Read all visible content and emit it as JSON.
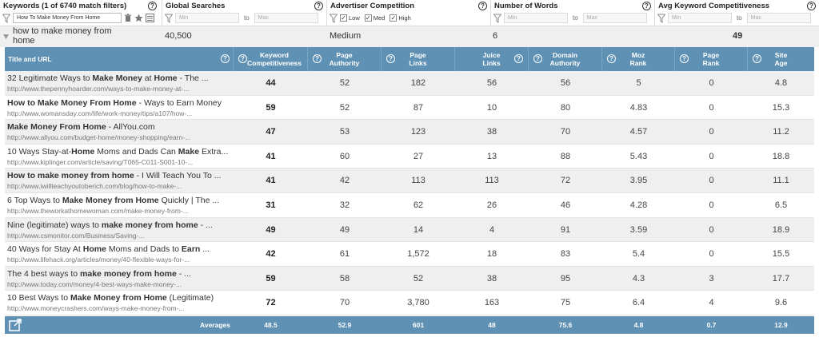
{
  "filters": {
    "keywords": {
      "title": "Keywords (1 of 6740 match filters)",
      "value": "How To Make Money From Home"
    },
    "global_searches": {
      "title": "Global Searches",
      "min_placeholder": "Min",
      "to": "to",
      "max_placeholder": "Max"
    },
    "advertiser_competition": {
      "title": "Advertiser Competition",
      "options": [
        "Low",
        "Med",
        "High"
      ]
    },
    "number_of_words": {
      "title": "Number of Words",
      "min_placeholder": "Min",
      "to": "to",
      "max_placeholder": "Max"
    },
    "avg_kc": {
      "title": "Avg Keyword Competitiveness",
      "min_placeholder": "Min",
      "to": "to",
      "max_placeholder": "Max"
    }
  },
  "summary": {
    "keyword_line1": "how to make money from",
    "keyword_line2": "home",
    "global_searches": "40,500",
    "competition": "Medium",
    "words": "6",
    "avg_kc": "49"
  },
  "columns": [
    {
      "label": "Title and URL"
    },
    {
      "label": "Keyword Competitiveness"
    },
    {
      "label": "Page Authority"
    },
    {
      "label": "Page Links"
    },
    {
      "label": "Juice Links"
    },
    {
      "label": "Domain Authority"
    },
    {
      "label": "Moz Rank"
    },
    {
      "label": "Page Rank"
    },
    {
      "label": "Site Age"
    }
  ],
  "rows": [
    {
      "title_html": "32 Legitimate Ways to <b>Make Money</b> at <b>Home</b> - The ...",
      "url": "http://www.thepennyhoarder.com/ways-to-make-money-at-...",
      "kc": "44",
      "pa": "52",
      "pl": "182",
      "jl": "56",
      "da": "56",
      "mr": "5",
      "pr": "0",
      "age": "4.8"
    },
    {
      "title_html": "<b>How to Make Money From Home</b> - Ways to Earn Money",
      "url": "http://www.womansday.com/life/work-money/tips/a107/how-...",
      "kc": "59",
      "pa": "52",
      "pl": "87",
      "jl": "10",
      "da": "80",
      "mr": "4.83",
      "pr": "0",
      "age": "15.3"
    },
    {
      "title_html": "<b>Make Money From Home</b> - AllYou.com",
      "url": "http://www.allyou.com/budget-home/money-shopping/earn-...",
      "kc": "47",
      "pa": "53",
      "pl": "123",
      "jl": "38",
      "da": "70",
      "mr": "4.57",
      "pr": "0",
      "age": "11.2"
    },
    {
      "title_html": "10 Ways Stay-at-<b>Home</b> Moms and Dads Can <b>Make</b> Extra...",
      "url": "http://www.kiplinger.com/article/saving/T065-C011-S001-10-...",
      "kc": "41",
      "pa": "60",
      "pl": "27",
      "jl": "13",
      "da": "88",
      "mr": "5.43",
      "pr": "0",
      "age": "18.8"
    },
    {
      "title_html": "<b>How to make money from home</b> - I Will Teach You To ...",
      "url": "http://www.iwillteachyoutoberich.com/blog/how-to-make-...",
      "kc": "41",
      "pa": "42",
      "pl": "113",
      "jl": "113",
      "da": "72",
      "mr": "3.95",
      "pr": "0",
      "age": "11.1"
    },
    {
      "title_html": "6 Top Ways to <b>Make Money from Home</b> Quickly | The ...",
      "url": "http://www.theworkathomewoman.com/make-money-from-...",
      "kc": "31",
      "pa": "32",
      "pl": "62",
      "jl": "26",
      "da": "46",
      "mr": "4.28",
      "pr": "0",
      "age": "6.5"
    },
    {
      "title_html": "Nine (legitimate) ways to <b>make money from home</b> - ...",
      "url": "http://www.csmonitor.com/Business/Saving-...",
      "kc": "49",
      "pa": "49",
      "pl": "14",
      "jl": "4",
      "da": "91",
      "mr": "3.59",
      "pr": "0",
      "age": "18.9"
    },
    {
      "title_html": "40 Ways for Stay At <b>Home</b> Moms and Dads to <b>Earn</b> ...",
      "url": "http://www.lifehack.org/articles/money/40-flexible-ways-for-...",
      "kc": "42",
      "pa": "61",
      "pl": "1,572",
      "jl": "18",
      "da": "83",
      "mr": "5.4",
      "pr": "0",
      "age": "15.5"
    },
    {
      "title_html": "The 4 best ways to <b>make money from home</b> - ...",
      "url": "http://www.today.com/money/4-best-ways-make-money-...",
      "kc": "59",
      "pa": "58",
      "pl": "52",
      "jl": "38",
      "da": "95",
      "mr": "4.3",
      "pr": "3",
      "age": "17.7"
    },
    {
      "title_html": "10 Best Ways to <b>Make Money from Home</b> (Legitimate)",
      "url": "http://www.moneycrashers.com/ways-make-money-from-...",
      "kc": "72",
      "pa": "70",
      "pl": "3,780",
      "jl": "163",
      "da": "75",
      "mr": "6.4",
      "pr": "4",
      "age": "9.6"
    }
  ],
  "averages": {
    "label": "Averages",
    "kc": "48.5",
    "pa": "52.9",
    "pl": "601",
    "jl": "48",
    "da": "75.6",
    "mr": "4.8",
    "pr": "0.7",
    "age": "12.9"
  },
  "colors": {
    "header_bg": "#5e91b4",
    "stripe": "#efefef"
  }
}
